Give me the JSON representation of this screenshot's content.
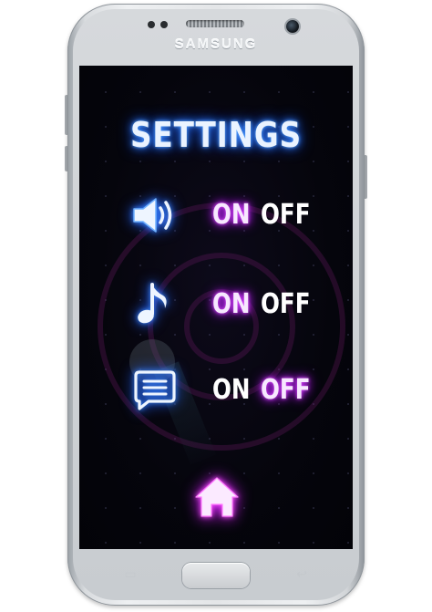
{
  "device": {
    "brand": "SAMSUNG"
  },
  "screen": {
    "title": "SETTINGS",
    "settings": [
      {
        "id": "sound",
        "icon": "speaker-icon",
        "on_label": "ON",
        "off_label": "OFF",
        "active": "on"
      },
      {
        "id": "music",
        "icon": "music-note-icon",
        "on_label": "ON",
        "off_label": "OFF",
        "active": "on"
      },
      {
        "id": "chat",
        "icon": "chat-bubble-icon",
        "on_label": "ON",
        "off_label": "OFF",
        "active": "off"
      }
    ],
    "home_button": {
      "icon": "home-icon"
    }
  },
  "colors": {
    "title_glow": "#2f7cff",
    "icon_glow": "#1e5fff",
    "active_glow": "#c02cff",
    "idle_text": "#ffffff",
    "background": "#05050c"
  }
}
